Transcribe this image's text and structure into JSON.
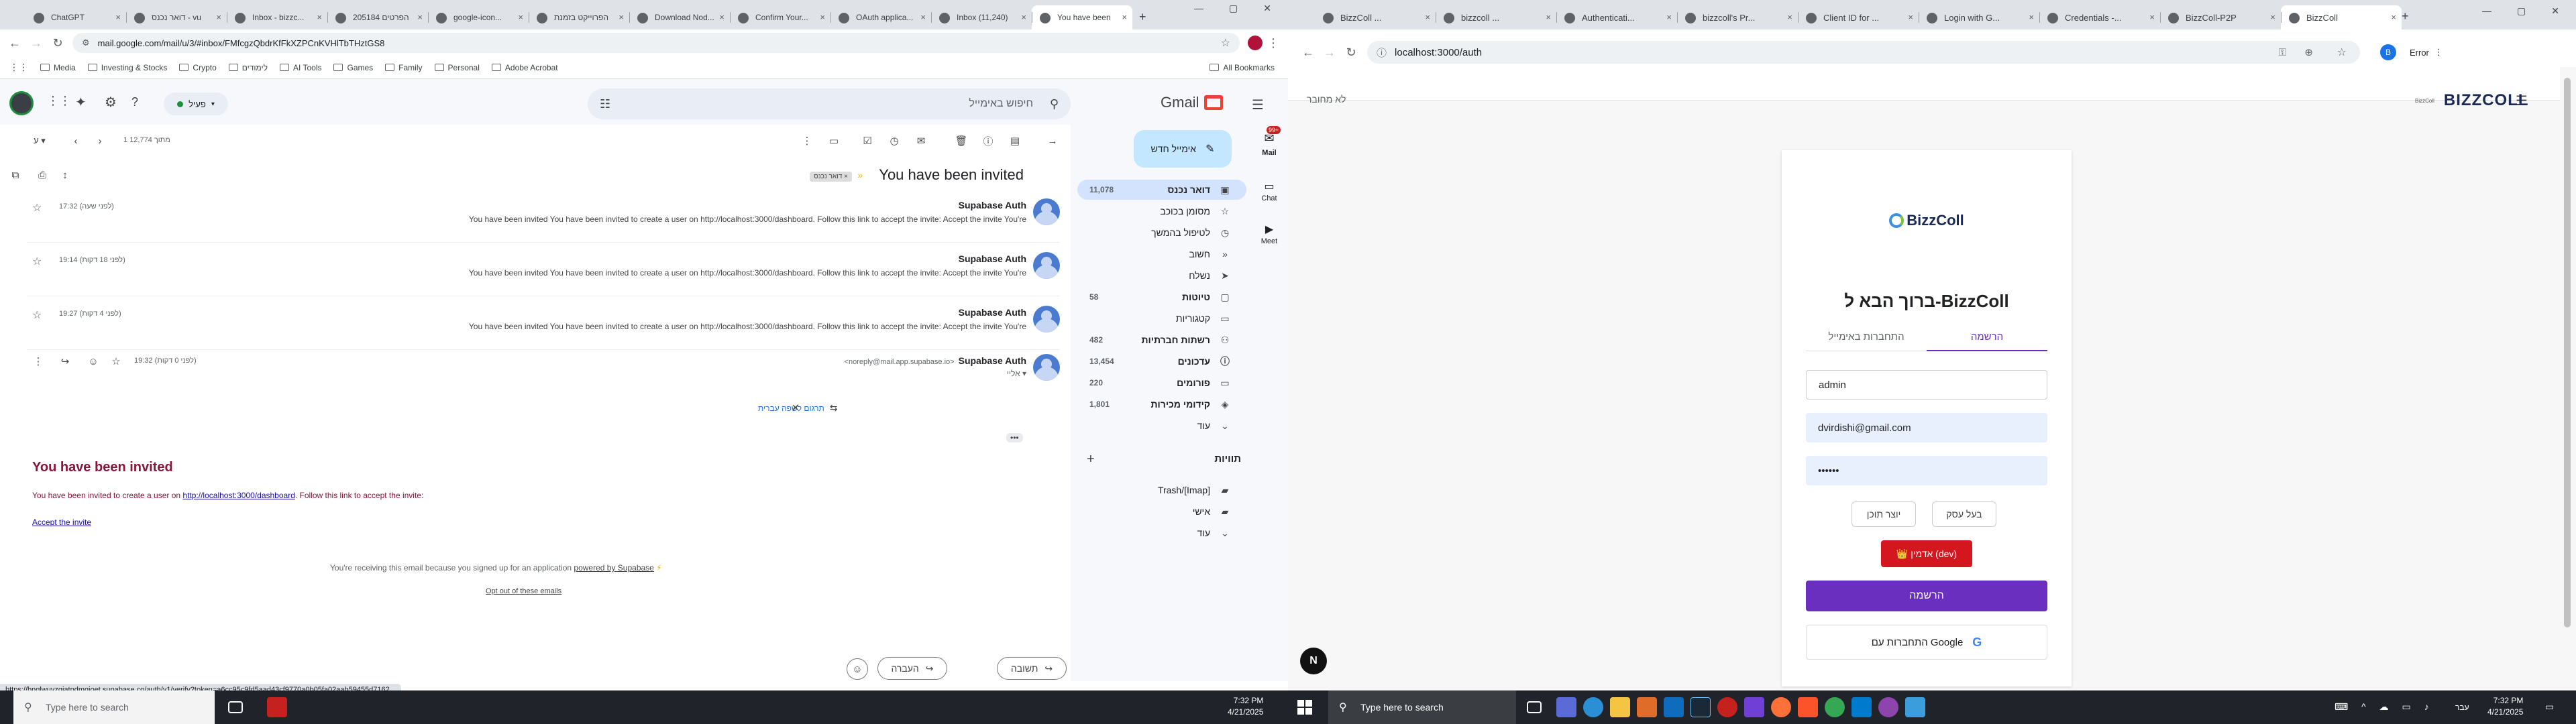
{
  "left_browser": {
    "tabs": [
      "ChatGPT",
      "דואר נכנס - vu",
      "Inbox - bizzc...",
      "205184 הפרטים",
      "google-icon...",
      "הפרוייקט בזמנת",
      "Download Nod...",
      "Confirm Your...",
      "OAuth applica...",
      "Inbox (11,240)",
      "You have been"
    ],
    "url": "mail.google.com/mail/u/3/#inbox/FMfcgzQbdrKfFkXZPCnKVHlTbTHztGS8",
    "bookmarks": [
      "Media",
      "Investing & Stocks",
      "Crypto",
      "לימודים",
      "AI Tools",
      "Games",
      "Family",
      "Personal",
      "Adobe Acrobat"
    ],
    "all_bookmarks": "All Bookmarks"
  },
  "gmail": {
    "logo": "Gmail",
    "search_placeholder": "חיפוש באימייל",
    "status": "פעיל",
    "compose": "אימייל חדש",
    "mail_badge": "99+",
    "rail": [
      "Mail",
      "Chat",
      "Meet"
    ],
    "nav": [
      {
        "label": "דואר נכנס",
        "count": "11,078"
      },
      {
        "label": "מסומן בכוכב",
        "count": ""
      },
      {
        "label": "לטיפול בהמשך",
        "count": ""
      },
      {
        "label": "חשוב",
        "count": ""
      },
      {
        "label": "נשלח",
        "count": ""
      },
      {
        "label": "טיוטות",
        "count": "58"
      },
      {
        "label": "קטגוריות",
        "count": ""
      },
      {
        "label": "רשתות חברתיות",
        "count": "482"
      },
      {
        "label": "עדכונים",
        "count": "13,454"
      },
      {
        "label": "פורומים",
        "count": "220"
      },
      {
        "label": "קידומי מכירות",
        "count": "1,801"
      },
      {
        "label": "עוד",
        "count": ""
      }
    ],
    "labels_title": "תוויות",
    "labels": [
      "Trash/[Imap]",
      "אישי",
      "עוד"
    ],
    "pager": "1 מתוך 12,774",
    "subject": "You have been invited",
    "inbox_chip": "דואר נכנס ×",
    "messages": [
      {
        "sender": "Supabase Auth",
        "date": "17:32 (לפני שעה)",
        "snippet": "You have been invited You have been invited to create a user on http://localhost:3000/dashboard. Follow this link to accept the invite: Accept the invite You're"
      },
      {
        "sender": "Supabase Auth",
        "date": "19:14 (לפני 18 דקות)",
        "snippet": "You have been invited You have been invited to create a user on http://localhost:3000/dashboard. Follow this link to accept the invite: Accept the invite You're"
      },
      {
        "sender": "Supabase Auth",
        "date": "19:27 (לפני 4 דקות)",
        "snippet": "You have been invited You have been invited to create a user on http://localhost:3000/dashboard. Follow this link to accept the invite: Accept the invite You're"
      }
    ],
    "expanded": {
      "sender": "Supabase Auth",
      "email": "<noreply@mail.app.supabase.io>",
      "to": "אליי",
      "date": "19:32 (לפני 0 דקות)"
    },
    "translate": "תרגום לשפה עברית",
    "body": {
      "heading": "You have been invited",
      "line_a": "You have been invited to create a user on",
      "link": "http://localhost:3000/dashboard",
      "line_b": ". Follow this link to accept the invite:",
      "accept": "Accept the invite",
      "footer_a": "You're receiving this email because you signed up for an application",
      "footer_link": "powered by Supabase",
      "optout": "Opt out of these emails"
    },
    "reply": "תשובה",
    "forward": "העברה",
    "status_url": "https://bnglwuvzqiatpdmqjoet.supabase.co/auth/v1/verify?token=a6cc95c9fd5aad43cf9770a0b05fa02aab59455d7162..."
  },
  "right_browser": {
    "tabs": [
      "BizzColl ...",
      "bizzcoll ...",
      "Authenticati...",
      "bizzcoll's Pr...",
      "Client ID for ...",
      "Login with G...",
      "Credentials -...",
      "BizzColl-P2P",
      "BizzColl"
    ],
    "url": "localhost:3000/auth",
    "error": "Error",
    "profile": "B"
  },
  "app": {
    "brand": "BIZZCOLL",
    "brand_small": "BizzColl",
    "not_connected": "לא מחובר",
    "logo_text": "BizzColl",
    "welcome": "ברוך הבא ל-BizzColl",
    "tab_signup": "הרשמה",
    "tab_login": "התחברות באימייל",
    "name": "admin",
    "email": "dvirdishi@gmail.com",
    "password": "••••••",
    "role_business": "בעל עסק",
    "role_creator": "יוצר תוכן",
    "admin_btn": "👑 אדמין (dev)",
    "submit": "הרשמה",
    "google": "התחברות עם Google",
    "fab": "N"
  },
  "taskbar": {
    "search": "Type here to search",
    "time": "7:32 PM",
    "date": "4/21/2025",
    "lang": "עבר"
  }
}
